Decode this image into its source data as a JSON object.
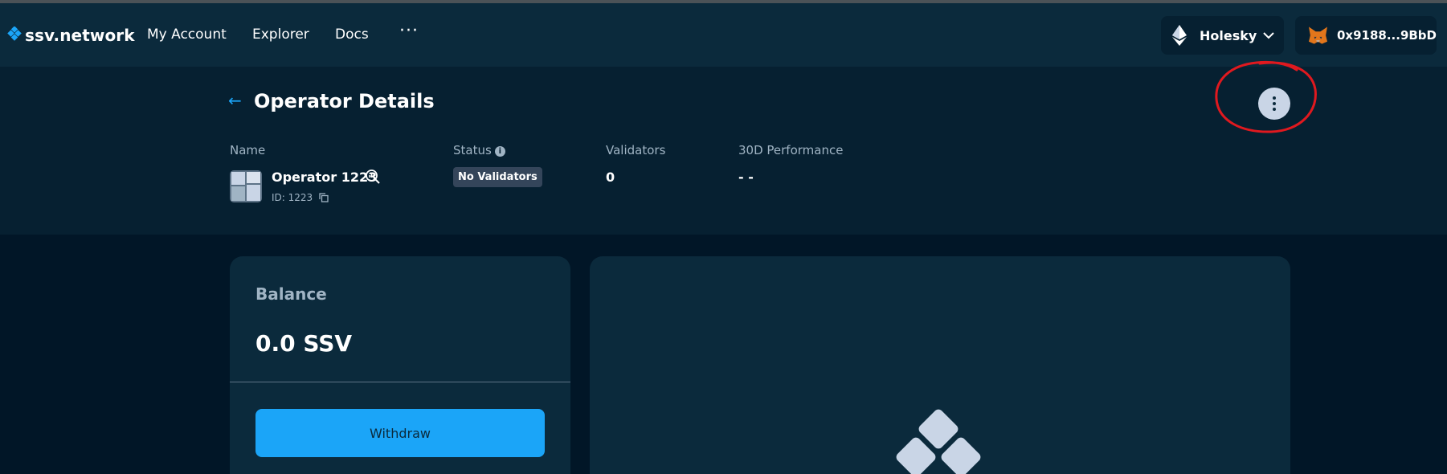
{
  "navbar": {
    "logo_text": "ssv.network",
    "links": [
      "My Account",
      "Explorer",
      "Docs"
    ],
    "more_label": "···",
    "network_label": "Holesky",
    "wallet_address": "0x9188...9BbD"
  },
  "details": {
    "title": "Operator Details",
    "columns": {
      "name": "Name",
      "status": "Status",
      "validators": "Validators",
      "performance": "30D Performance"
    },
    "operator_name": "Operator 1223",
    "operator_id": "ID: 1223",
    "status_badge": "No Validators",
    "validators_value": "0",
    "performance_value": "- -"
  },
  "balance": {
    "label": "Balance",
    "value": "0.0 SSV",
    "withdraw_label": "Withdraw"
  },
  "icons": {
    "logo": "ssv-logo-icon",
    "network": "ethereum-icon",
    "wallet": "metamask-fox-icon",
    "more_options": "more-vertical-icon",
    "back": "arrow-left-icon",
    "info": "info-icon",
    "explore": "search-chart-icon",
    "copy": "copy-icon"
  },
  "colors": {
    "accent": "#1ba5f8",
    "background": "#011627",
    "surface": "#0b2a3c",
    "annotation": "#e0191f"
  }
}
